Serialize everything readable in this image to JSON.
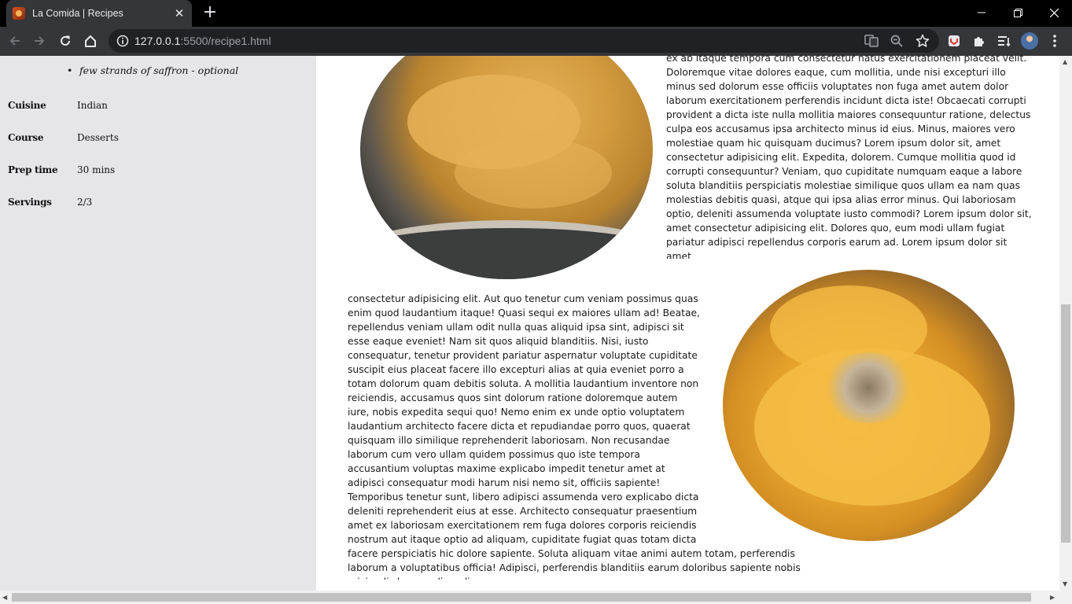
{
  "browser": {
    "tab_title": "La Comida | Recipes",
    "url_host": "127.0.0.1",
    "url_rest": ":5500/recipe1.html",
    "icons": [
      "back-icon",
      "forward-icon",
      "reload-icon",
      "home-icon",
      "info-icon",
      "translate-icon",
      "zoom-icon",
      "star-icon",
      "extension-icon",
      "puzzle-icon",
      "reading-list-icon",
      "avatar",
      "menu-icon"
    ]
  },
  "sidebar": {
    "ingredient_last": "few strands of saffron - optional",
    "meta": [
      {
        "key": "Cuisine",
        "value": "Indian"
      },
      {
        "key": "Course",
        "value": "Desserts"
      },
      {
        "key": "Prep time",
        "value": "30 mins"
      },
      {
        "key": "Servings",
        "value": "2/3"
      }
    ]
  },
  "main": {
    "paragraph1": "ex ab itaque tempora cum consectetur natus exercitationem placeat velit. Doloremque vitae dolores eaque, cum mollitia, unde nisi excepturi illo minus sed dolorum esse officiis voluptates non fuga amet autem dolor laborum exercitationem perferendis incidunt dicta iste! Obcaecati corrupti provident a dicta iste nulla mollitia maiores consequuntur ratione, delectus culpa eos accusamus ipsa architecto minus id eius. Minus, maiores vero molestiae quam hic quisquam ducimus? Lorem ipsum dolor sit, amet consectetur adipisicing elit. Expedita, dolorem. Cumque mollitia quod id corrupti consequuntur? Veniam, quo cupiditate numquam eaque a labore soluta blanditiis perspiciatis molestiae similique quos ullam ea nam quas molestias debitis quasi, atque qui ipsa alias error minus. Qui laboriosam optio, deleniti assumenda voluptate iusto commodi? Lorem ipsum dolor sit, amet consectetur adipisicing elit. Dolores quo, eum modi ullam fugiat pariatur adipisci repellendus corporis earum ad. Lorem ipsum dolor sit amet",
    "paragraph2": "consectetur adipisicing elit. Aut quo tenetur cum veniam possimus quas enim quod laudantium itaque! Quasi sequi ex maiores ullam ad! Beatae, repellendus veniam ullam odit nulla quas aliquid ipsa sint, adipisci sit esse eaque eveniet! Nam sit quos aliquid blanditiis. Nisi, iusto consequatur, tenetur provident pariatur aspernatur voluptate cupiditate suscipit eius placeat facere illo excepturi alias at quia eveniet porro a totam dolorum quam debitis soluta. A mollitia laudantium inventore non reiciendis, accusamus quos sint dolorum ratione doloremque autem iure, nobis expedita sequi quo! Nemo enim ex unde optio voluptatem laudantium architecto facere dicta et repudiandae porro quos, quaerat quisquam illo similique reprehenderit laboriosam. Non recusandae laborum cum vero ullam quidem possimus quo iste tempora accusantium voluptas maxime explicabo impedit tenetur amet at adipisci consequatur modi harum nisi nemo sit, officiis sapiente! Temporibus tenetur sunt, libero adipisci assumenda vero explicabo dicta deleniti reprehenderit eius at esse. Architecto consequatur praesentium amet ex laboriosam exercitationem rem fuga dolores corporis reiciendis nostrum aut itaque optio ad aliquam, cupiditate fugiat quas totam dicta facere perspiciatis hic dolore sapiente. Soluta aliquam vitae animi autem totam, perferendis laborum a voluptatibus officia! Adipisci, perferendis blanditiis earum doloribus sapiente nobis reiciendis harum eligendi."
  },
  "colors": {
    "tabstrip": "#000000",
    "toolbar": "#35363a",
    "sidebar_bg": "#e6e5e7",
    "page_bg": "#ffffff"
  }
}
